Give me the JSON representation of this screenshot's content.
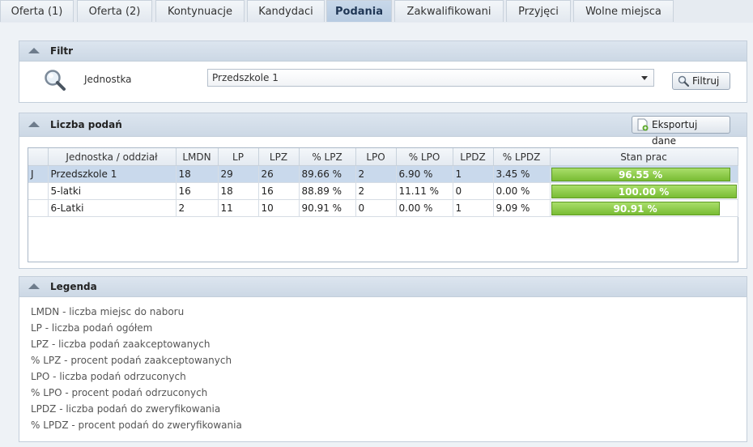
{
  "tabs": [
    {
      "label": "Oferta (1)"
    },
    {
      "label": "Oferta (2)"
    },
    {
      "label": "Kontynuacje"
    },
    {
      "label": "Kandydaci"
    },
    {
      "label": "Podania",
      "active": true
    },
    {
      "label": "Zakwalifikowani"
    },
    {
      "label": "Przyjęci"
    },
    {
      "label": "Wolne miejsca"
    }
  ],
  "filter": {
    "title": "Filtr",
    "unit_label": "Jednostka",
    "unit_value": "Przedszkole 1",
    "button_label": "Filtruj"
  },
  "applications": {
    "title": "Liczba podań",
    "export_label": "Eksportuj dane",
    "columns": [
      "",
      "Jednostka / oddział",
      "LMDN",
      "LP",
      "LPZ",
      "% LPZ",
      "LPO",
      "% LPO",
      "LPDZ",
      "% LPDZ",
      "Stan prac"
    ],
    "rows": [
      {
        "mark": "J",
        "unit": "Przedszkole 1",
        "lmdn": "18",
        "lp": "29",
        "lpz": "26",
        "plpz": "89.66 %",
        "lpo": "2",
        "plpo": "6.90 %",
        "lpdz": "1",
        "plpdz": "3.45 %",
        "progress_label": "96.55 %",
        "progress": 0.9655,
        "selected": true
      },
      {
        "mark": "",
        "unit": "5-latki",
        "lmdn": "16",
        "lp": "18",
        "lpz": "16",
        "plpz": "88.89 %",
        "lpo": "2",
        "plpo": "11.11 %",
        "lpdz": "0",
        "plpdz": "0.00 %",
        "progress_label": "100.00 %",
        "progress": 1.0,
        "selected": false
      },
      {
        "mark": "",
        "unit": "6-Latki",
        "lmdn": "2",
        "lp": "11",
        "lpz": "10",
        "plpz": "90.91 %",
        "lpo": "0",
        "plpo": "0.00 %",
        "lpdz": "1",
        "plpdz": "9.09 %",
        "progress_label": "90.91 %",
        "progress": 0.9091,
        "selected": false
      }
    ]
  },
  "legend": {
    "title": "Legenda",
    "items": [
      "LMDN - liczba miejsc do naboru",
      "LP - liczba podań ogółem",
      "LPZ - liczba podań zaakceptowanych",
      "% LPZ - procent podań zaakceptowanych",
      "LPO - liczba podań odrzuconych",
      "% LPO - procent podań odrzuconych",
      "LPDZ - liczba podań do zweryfikowania",
      "% LPDZ - procent podań do zweryfikowania"
    ]
  },
  "colors": {
    "accent": "#b7cbe1",
    "progress": "#8fcd4a",
    "selected_row": "#c9d9ec"
  },
  "icons": {
    "filter_panel": "magnifier-icon",
    "filter_button": "search-icon",
    "export_button": "export-document-icon",
    "collapse": "collapse-arrow-icon"
  }
}
